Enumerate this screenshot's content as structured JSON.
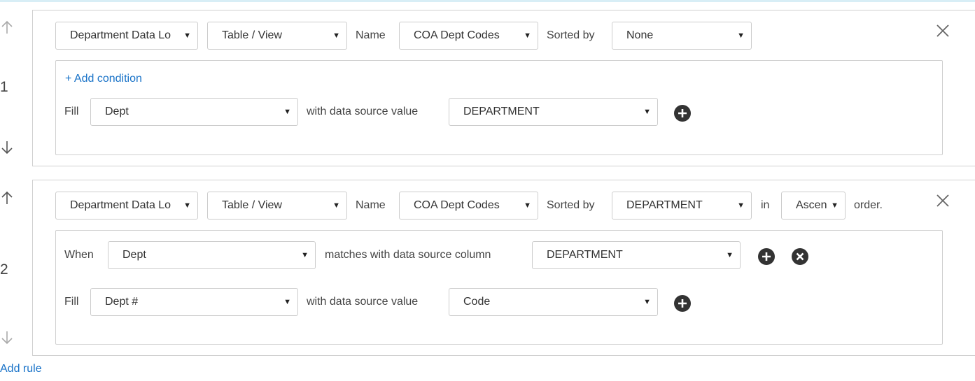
{
  "rules": [
    {
      "number": "1",
      "source": "Department Data Lo",
      "source_type": "Table / View",
      "name_label": "Name",
      "name_value": "COA Dept Codes",
      "sorted_by_label": "Sorted by",
      "sorted_by_value": "None",
      "add_condition": "+ Add condition",
      "fill_label": "Fill",
      "fill_field": "Dept",
      "with_label": "with data source value",
      "with_value": "DEPARTMENT"
    },
    {
      "number": "2",
      "source": "Department Data Lo",
      "source_type": "Table / View",
      "name_label": "Name",
      "name_value": "COA Dept Codes",
      "sorted_by_label": "Sorted by",
      "sorted_by_value": "DEPARTMENT",
      "in_label": "in",
      "order_value": "Ascen",
      "order_label": "order.",
      "when_label": "When",
      "when_field": "Dept",
      "matches_label": "matches with data source column",
      "matches_value": "DEPARTMENT",
      "fill_label": "Fill",
      "fill_field": "Dept #",
      "with_label": "with data source value",
      "with_value": "Code"
    }
  ],
  "add_rule": "Add rule",
  "colors": {
    "link": "#1a73c8",
    "border": "#d0d0d0",
    "icon_dark": "#333333",
    "arrow_light": "#aaaaaa"
  }
}
